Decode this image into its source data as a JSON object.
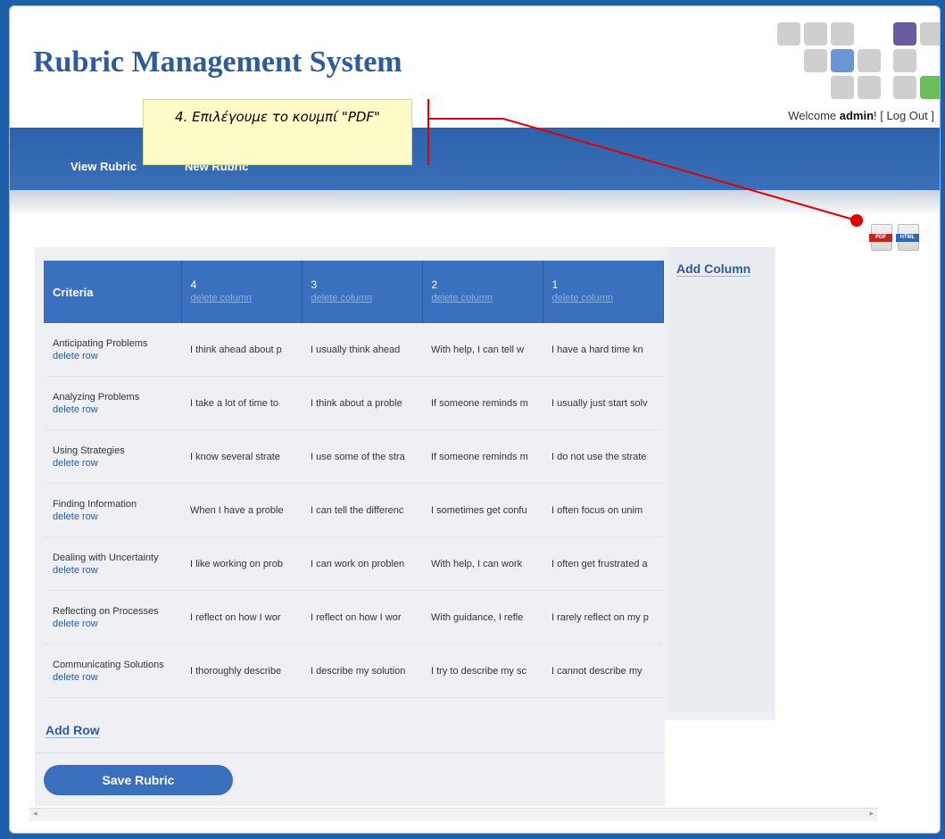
{
  "app": {
    "title": "Rubric Management System"
  },
  "header": {
    "welcome_prefix": "Welcome ",
    "user": "admin",
    "welcome_suffix": "! [ ",
    "logout": "Log Out",
    "logout_close": " ]"
  },
  "nav": {
    "items": [
      {
        "label": "View Rubric"
      },
      {
        "label": "New Rubric"
      }
    ]
  },
  "callout": {
    "text": "4. Επιλέγουμε το κουμπί \"PDF\""
  },
  "export": {
    "pdf_label": "PDF",
    "html_label": "HTML"
  },
  "table": {
    "criteria_header": "Criteria",
    "columns": [
      {
        "level": "4",
        "action": "delete column"
      },
      {
        "level": "3",
        "action": "delete column"
      },
      {
        "level": "2",
        "action": "delete column"
      },
      {
        "level": "1",
        "action": "delete column"
      }
    ],
    "rows": [
      {
        "criterion": "Anticipating Problems",
        "action": "delete row",
        "cells": [
          "I think ahead about p",
          "I usually think ahead",
          "With help, I can tell w",
          "I have a hard time kn"
        ]
      },
      {
        "criterion": "Analyzing Problems",
        "action": "delete row",
        "cells": [
          "I take a lot of time to",
          "I think about a proble",
          "If someone reminds m",
          "I usually just start solv"
        ]
      },
      {
        "criterion": "Using Strategies",
        "action": "delete row",
        "cells": [
          "I know several strate",
          "I use some of the stra",
          "If someone reminds m",
          "I do not use the strate"
        ]
      },
      {
        "criterion": "Finding Information",
        "action": "delete row",
        "cells": [
          "When I have a proble",
          "I can tell the differenc",
          "I sometimes get confu",
          "I often focus on unim"
        ]
      },
      {
        "criterion": "Dealing with Uncertainty",
        "action": "delete row",
        "cells": [
          "I like working on prob",
          "I can work on problen",
          "With help, I can work",
          "I often get frustrated a"
        ]
      },
      {
        "criterion": "Reflecting on Processes",
        "action": "delete row",
        "cells": [
          "I reflect on how I wor",
          "I reflect on how I wor",
          "With guidance, I refle",
          "I rarely reflect on my p"
        ]
      },
      {
        "criterion": "Communicating Solutions",
        "action": "delete row",
        "cells": [
          "I thoroughly describe",
          "I describe my solution",
          "I try to describe my sc",
          "I cannot describe my"
        ]
      }
    ],
    "add_column": "Add Column",
    "add_row": "Add Row"
  },
  "actions": {
    "save": "Save Rubric"
  },
  "colors": {
    "brand": "#2d5c9a",
    "header_blue": "#3a70be",
    "annotation_red": "#e00000",
    "callout_bg": "#fdfbc7"
  }
}
